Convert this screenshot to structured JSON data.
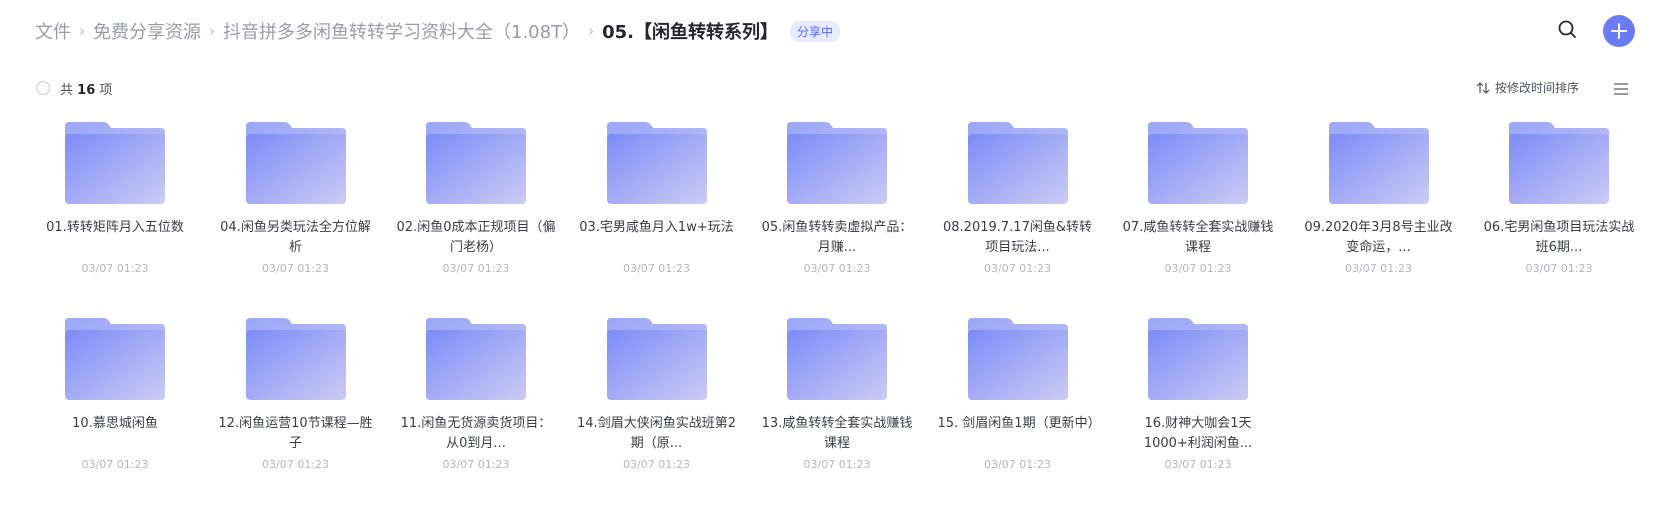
{
  "breadcrumb": {
    "items": [
      "文件",
      "免费分享资源",
      "抖音拼多多闲鱼转转学习资料大全（1.08T）"
    ],
    "separator": "›",
    "current": "05.【闲鱼转转系列】",
    "badge": "分享中"
  },
  "toolbar": {
    "search_icon": "search-icon",
    "add_icon": "plus-icon",
    "accent_color": "#6a7bf6"
  },
  "list_header": {
    "count_prefix": "共",
    "count_value": "16",
    "count_suffix": "项",
    "sort_label": "按修改时间排序",
    "sort_icon": "sort-arrows-icon",
    "view_icon": "list-view-icon"
  },
  "files": [
    {
      "name": "01.转转矩阵月入五位数",
      "date": "03/07 01:23"
    },
    {
      "name": "04.闲鱼另类玩法全方位解析",
      "date": "03/07 01:23"
    },
    {
      "name": "02.闲鱼0成本正规项目（偏门老杨）",
      "date": "03/07 01:23"
    },
    {
      "name": "03.宅男咸鱼月入1w+玩法",
      "date": "03/07 01:23"
    },
    {
      "name": "05.闲鱼转转卖虚拟产品：月赚...",
      "date": "03/07 01:23"
    },
    {
      "name": "08.2019.7.17闲鱼&转转项目玩法...",
      "date": "03/07 01:23"
    },
    {
      "name": "07.咸鱼转转全套实战赚钱课程",
      "date": "03/07 01:23"
    },
    {
      "name": "09.2020年3月8号主业改变命运，...",
      "date": "03/07 01:23"
    },
    {
      "name": "06.宅男闲鱼项目玩法实战班6期...",
      "date": "03/07 01:23"
    },
    {
      "name": "10.慕思城闲鱼",
      "date": "03/07 01:23"
    },
    {
      "name": "12.闲鱼运营10节课程—胜子",
      "date": "03/07 01:23"
    },
    {
      "name": "11.闲鱼无货源卖货项目：从0到月...",
      "date": "03/07 01:23"
    },
    {
      "name": "14.剑眉大侠闲鱼实战班第2期（原...",
      "date": "03/07 01:23"
    },
    {
      "name": "13.咸鱼转转全套实战赚钱课程",
      "date": "03/07 01:23"
    },
    {
      "name": "15. 剑眉闲鱼1期（更新中）",
      "date": "03/07 01:23"
    },
    {
      "name": "16.财神大咖会1天1000+利润闲鱼...",
      "date": "03/07 01:23"
    }
  ]
}
